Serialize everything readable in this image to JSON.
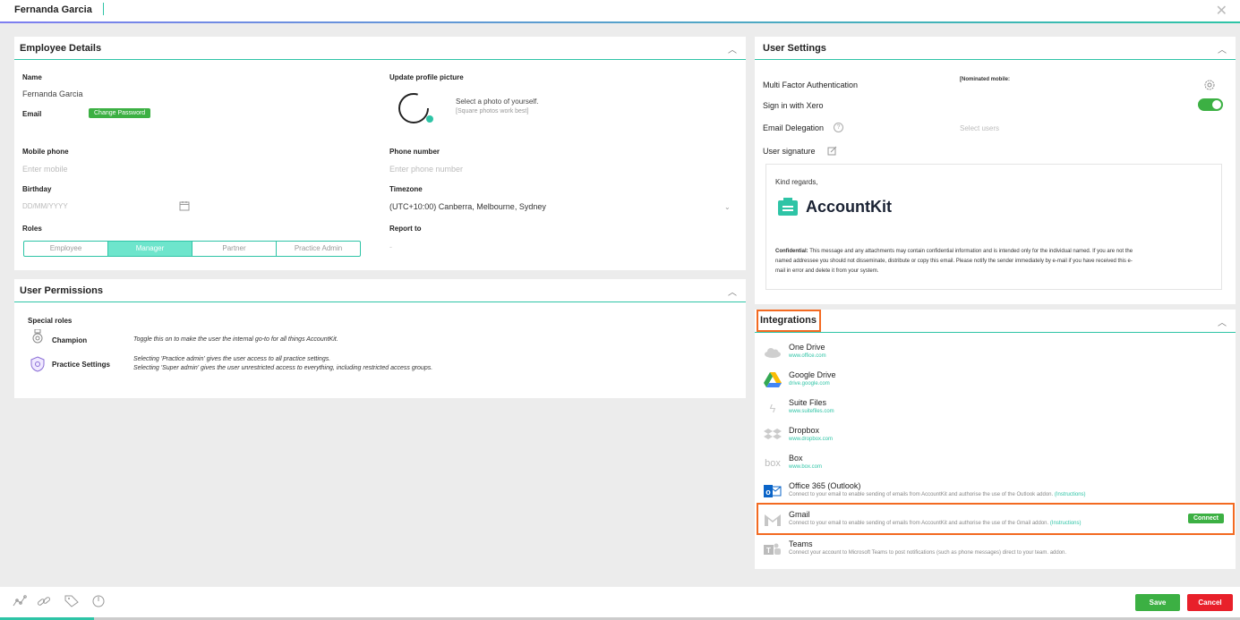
{
  "header": {
    "user_name": "Fernanda Garcia",
    "close": "✕"
  },
  "employee_details": {
    "title": "Employee Details",
    "name_label": "Name",
    "name_value": "Fernanda Garcia",
    "email_label": "Email",
    "change_password": "Change Password",
    "update_picture_label": "Update profile picture",
    "photo_hint": "Select a photo of yourself.",
    "photo_hint_sub": "[Square photos work best]",
    "mobile_label": "Mobile phone",
    "mobile_placeholder": "Enter mobile",
    "phone_label": "Phone number",
    "phone_placeholder": "Enter phone number",
    "birthday_label": "Birthday",
    "birthday_placeholder": "DD/MM/YYYY",
    "timezone_label": "Timezone",
    "timezone_value": "(UTC+10:00) Canberra, Melbourne, Sydney",
    "roles_label": "Roles",
    "roles": [
      "Employee",
      "Manager",
      "Partner",
      "Practice Admin"
    ],
    "active_role": "Manager",
    "report_to_label": "Report to",
    "report_to_value": "-"
  },
  "user_permissions": {
    "title": "User Permissions",
    "special_roles": "Special roles",
    "champion_label": "Champion",
    "champion_desc": "Toggle this on to make the user the internal go-to for all things AccountKit.",
    "practice_label": "Practice Settings",
    "practice_desc1": "Selecting 'Practice admin' gives the user access to all practice settings.",
    "practice_desc2": "Selecting 'Super admin' gives the user unrestricted access to everything, including restricted access groups."
  },
  "user_settings": {
    "title": "User Settings",
    "mfa_label": "Multi Factor Authentication",
    "nominated_mobile": "[Nominated mobile:",
    "xero_label": "Sign in with Xero",
    "xero_on": true,
    "email_delegation_label": "Email Delegation",
    "select_users": "Select users",
    "signature_label": "User signature",
    "sig_greeting": "Kind regards,",
    "sig_brand": "AccountKit",
    "sig_conf_bold": "Confidential:",
    "sig_conf_text1": " This message and any attachments may contain confidential information and is intended only for the individual named. If you are not the",
    "sig_conf_text2": "named addressee you should not disseminate, distribute or copy this email. Please notify the sender immediately by e-mail if you have received this e-",
    "sig_conf_text3": "mail in error and delete it from your system."
  },
  "integrations": {
    "title": "Integrations",
    "items": [
      {
        "name": "One Drive",
        "sub": "www.office.com"
      },
      {
        "name": "Google Drive",
        "sub": "drive.google.com"
      },
      {
        "name": "Suite Files",
        "sub": "www.suitefiles.com"
      },
      {
        "name": "Dropbox",
        "sub": "www.dropbox.com"
      },
      {
        "name": "Box",
        "sub": "www.box.com"
      },
      {
        "name": "Office 365 (Outlook)",
        "sub": "Connect to your email to enable sending of emails from AccountKit and authorise the use of the Outlook addon.",
        "link": "(Instructions)"
      },
      {
        "name": "Gmail",
        "sub": "Connect to your email to enable sending of emails from AccountKit and authorise the use of the Gmail addon.",
        "link": "(Instructions)",
        "action": "Connect"
      },
      {
        "name": "Teams",
        "sub": "Connect your account to Microsoft Teams to post notifications (such as phone messages) direct to your team. addon."
      }
    ]
  },
  "footer": {
    "save": "Save",
    "cancel": "Cancel"
  },
  "colors": {
    "accent": "#2ec4a6",
    "green": "#3cb043",
    "red": "#e8202a",
    "highlight": "#f36a21"
  }
}
